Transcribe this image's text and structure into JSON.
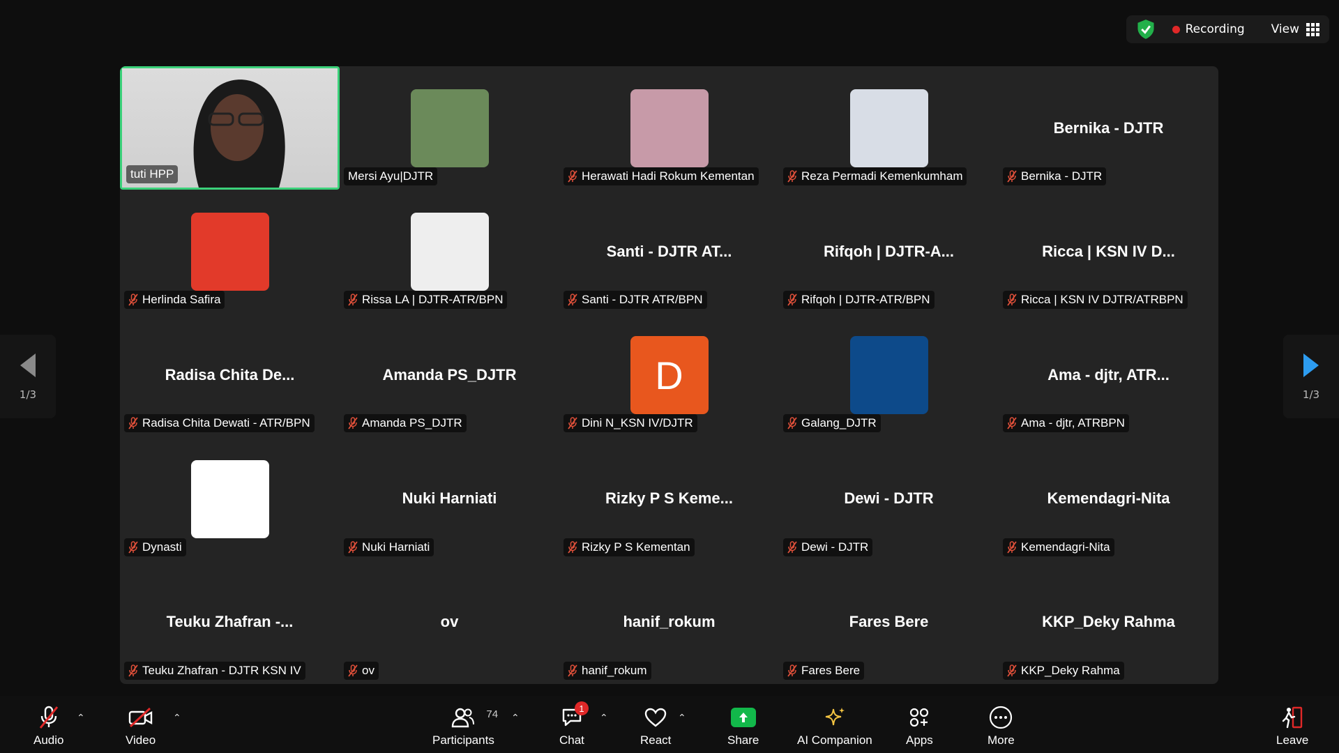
{
  "topbar": {
    "recording_label": "Recording",
    "view_label": "View"
  },
  "pager": {
    "left_label": "1/3",
    "right_label": "1/3"
  },
  "tiles": [
    {
      "tag": "tuti HPP",
      "kind": "video"
    },
    {
      "tag": "Mersi Ayu|DJTR",
      "kind": "photo",
      "color": "#6b8a5a"
    },
    {
      "tag": "Herawati Hadi Rokum Kementan",
      "kind": "photo",
      "color": "#c79aa8"
    },
    {
      "tag": "Reza Permadi Kemenkumham",
      "kind": "photo",
      "color": "#d8dde6"
    },
    {
      "tag": "Bernika - DJTR",
      "big": "Bernika - DJTR",
      "kind": "name"
    },
    {
      "tag": "Herlinda Safira",
      "kind": "photo",
      "color": "#e23a2a"
    },
    {
      "tag": "Rissa LA | DJTR-ATR/BPN",
      "kind": "photo",
      "color": "#eeeeee"
    },
    {
      "tag": "Santi - DJTR ATR/BPN",
      "big": "Santi - DJTR AT...",
      "kind": "name"
    },
    {
      "tag": "Rifqoh | DJTR-ATR/BPN",
      "big": "Rifqoh | DJTR-A...",
      "kind": "name"
    },
    {
      "tag": "Ricca | KSN IV DJTR/ATRBPN",
      "big": "Ricca | KSN IV D...",
      "kind": "name"
    },
    {
      "tag": "Radisa Chita Dewati - ATR/BPN",
      "big": "Radisa Chita De...",
      "kind": "name"
    },
    {
      "tag": "Amanda PS_DJTR",
      "big": "Amanda PS_DJTR",
      "kind": "name"
    },
    {
      "tag": "Dini N_KSN IV/DJTR",
      "kind": "letter",
      "letter": "D",
      "color": "#e8571e"
    },
    {
      "tag": "Galang_DJTR",
      "kind": "photo",
      "color": "#0d4a8a"
    },
    {
      "tag": "Ama - djtr, ATRBPN",
      "big": "Ama - djtr, ATR...",
      "kind": "name"
    },
    {
      "tag": "Dynasti",
      "kind": "photo",
      "color": "#ffffff"
    },
    {
      "tag": "Nuki Harniati",
      "big": "Nuki Harniati",
      "kind": "name"
    },
    {
      "tag": "Rizky P S Kementan",
      "big": "Rizky P S Keme...",
      "kind": "name"
    },
    {
      "tag": "Dewi - DJTR",
      "big": "Dewi - DJTR",
      "kind": "name"
    },
    {
      "tag": "Kemendagri-Nita",
      "big": "Kemendagri-Nita",
      "kind": "name"
    },
    {
      "tag": "Teuku Zhafran - DJTR KSN IV",
      "big": "Teuku Zhafran -...",
      "kind": "name"
    },
    {
      "tag": "ov",
      "big": "ov",
      "kind": "name"
    },
    {
      "tag": "hanif_rokum",
      "big": "hanif_rokum",
      "kind": "name"
    },
    {
      "tag": "Fares Bere",
      "big": "Fares Bere",
      "kind": "name"
    },
    {
      "tag": "KKP_Deky Rahma",
      "big": "KKP_Deky Rahma",
      "kind": "name"
    }
  ],
  "toolbar": {
    "audio": "Audio",
    "video": "Video",
    "participants": "Participants",
    "participants_count": "74",
    "chat": "Chat",
    "chat_badge": "1",
    "react": "React",
    "share": "Share",
    "ai": "AI Companion",
    "apps": "Apps",
    "more": "More",
    "leave": "Leave"
  }
}
